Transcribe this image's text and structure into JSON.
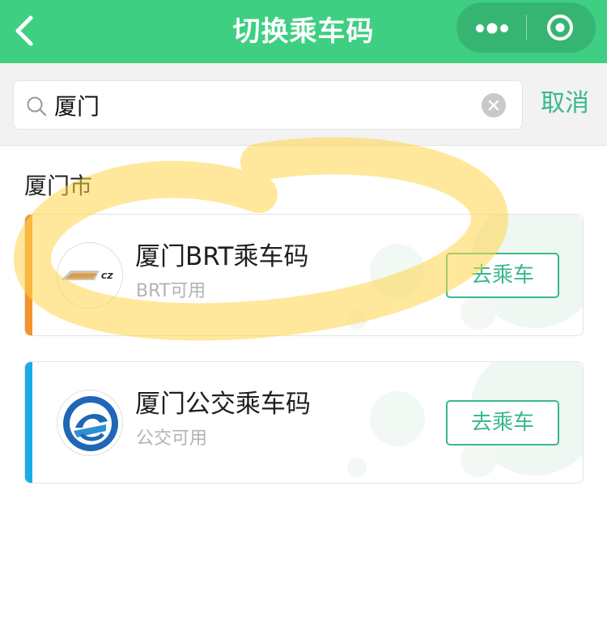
{
  "header": {
    "title": "切换乘车码",
    "back_icon": "chevron-left-icon",
    "more_icon": "more-dots-icon",
    "close_icon": "target-circle-icon",
    "background_color": "#3ecf82"
  },
  "search": {
    "value": "厦门",
    "placeholder": "",
    "search_icon": "search-icon",
    "clear_icon": "clear-icon",
    "cancel_label": "取消"
  },
  "section": {
    "title": "厦门市"
  },
  "cards": [
    {
      "name": "厦门BRT乘车码",
      "status": "BRT可用",
      "button_label": "去乘车",
      "accent_color": "#f5932f",
      "logo_text": "CZ",
      "logo_icon": "brt-logo-icon"
    },
    {
      "name": "厦门公交乘车码",
      "status": "公交可用",
      "button_label": "去乘车",
      "accent_color": "#1aace6",
      "logo_icon": "bus-company-logo-icon"
    }
  ],
  "colors": {
    "accent_green": "#3ab88a",
    "highlight_yellow": "#ffd54a"
  }
}
